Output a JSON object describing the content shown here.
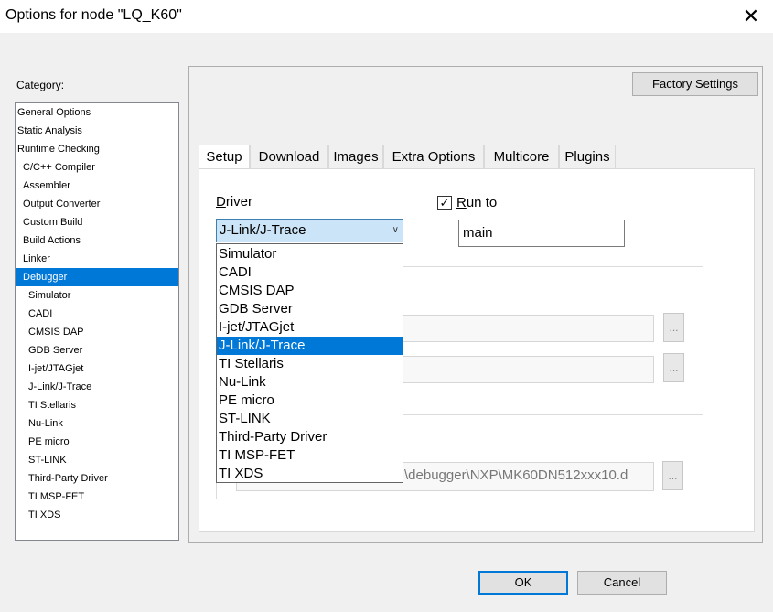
{
  "window": {
    "title": "Options for node \"LQ_K60\"",
    "close_glyph": "✕"
  },
  "category": {
    "label": "Category:",
    "items": [
      {
        "label": "General Options",
        "level": 0
      },
      {
        "label": "Static Analysis",
        "level": 0
      },
      {
        "label": "Runtime Checking",
        "level": 0
      },
      {
        "label": "C/C++ Compiler",
        "level": 1
      },
      {
        "label": "Assembler",
        "level": 1
      },
      {
        "label": "Output Converter",
        "level": 1
      },
      {
        "label": "Custom Build",
        "level": 1
      },
      {
        "label": "Build Actions",
        "level": 1
      },
      {
        "label": "Linker",
        "level": 1
      },
      {
        "label": "Debugger",
        "level": 1,
        "selected": true
      },
      {
        "label": "Simulator",
        "level": 2
      },
      {
        "label": "CADI",
        "level": 2
      },
      {
        "label": "CMSIS DAP",
        "level": 2
      },
      {
        "label": "GDB Server",
        "level": 2
      },
      {
        "label": "I-jet/JTAGjet",
        "level": 2
      },
      {
        "label": "J-Link/J-Trace",
        "level": 2
      },
      {
        "label": "TI Stellaris",
        "level": 2
      },
      {
        "label": "Nu-Link",
        "level": 2
      },
      {
        "label": "PE micro",
        "level": 2
      },
      {
        "label": "ST-LINK",
        "level": 2
      },
      {
        "label": "Third-Party Driver",
        "level": 2
      },
      {
        "label": "TI MSP-FET",
        "level": 2
      },
      {
        "label": "TI XDS",
        "level": 2
      }
    ]
  },
  "factory_settings_label": "Factory Settings",
  "tabs": [
    {
      "label": "Setup",
      "active": true
    },
    {
      "label": "Download"
    },
    {
      "label": "Images"
    },
    {
      "label": "Extra Options"
    },
    {
      "label": "Multicore"
    },
    {
      "label": "Plugins"
    }
  ],
  "setup": {
    "driver_label_accel": "D",
    "driver_label_rest": "river",
    "driver_value": "J-Link/J-Trace",
    "driver_options": [
      "Simulator",
      "CADI",
      "CMSIS DAP",
      "GDB Server",
      "I-jet/JTAGjet",
      "J-Link/J-Trace",
      "TI Stellaris",
      "Nu-Link",
      "PE micro",
      "ST-LINK",
      "Third-Party Driver",
      "TI MSP-FET",
      "TI XDS"
    ],
    "driver_selected_index": 5,
    "run_to_checked": true,
    "run_to_check_glyph": "✓",
    "run_to_label_accel": "R",
    "run_to_label_rest": "un to",
    "run_to_value": "main",
    "device_path_visible": "\\debugger\\NXP\\MK60DN512xxx10.d",
    "browse_label": "..."
  },
  "buttons": {
    "ok": "OK",
    "cancel": "Cancel"
  }
}
